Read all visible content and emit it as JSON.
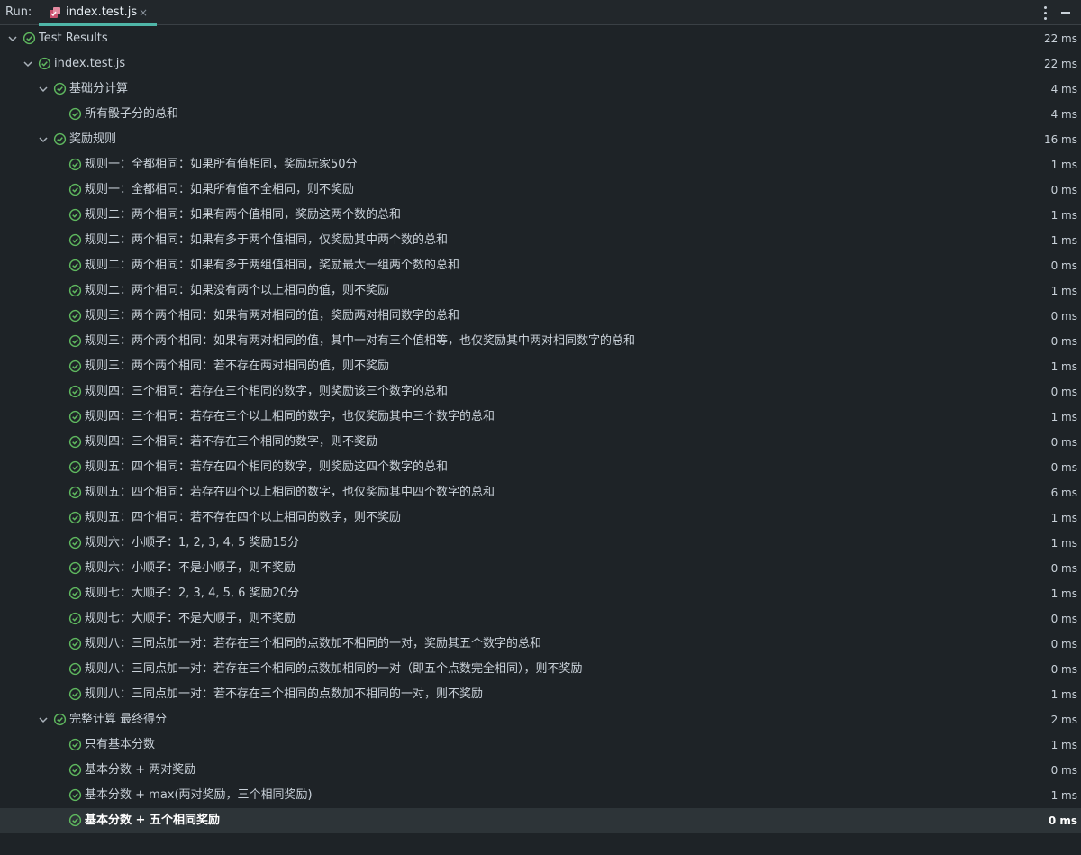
{
  "header": {
    "run_label": "Run:",
    "tab_title": "index.test.js",
    "tab_close": "×"
  },
  "colors": {
    "pass": "#5fb85f",
    "accent": "#4fb6a8",
    "background": "#1e2327",
    "selected_row": "#2d3438"
  },
  "icons": {
    "tab": "js-test-file-icon",
    "status": "passed-check-icon",
    "expand": "chevron-down-icon",
    "menu": "more-vertical-icon",
    "minimize": "minimize-icon"
  },
  "tree": [
    {
      "label": "Test Results",
      "duration": "22 ms",
      "level": 0,
      "expandable": true
    },
    {
      "label": "index.test.js",
      "duration": "22 ms",
      "level": 1,
      "expandable": true
    },
    {
      "label": "基础分计算",
      "duration": "4 ms",
      "level": 2,
      "expandable": true
    },
    {
      "label": "所有骰子分的总和",
      "duration": "4 ms",
      "level": 3,
      "expandable": false
    },
    {
      "label": "奖励规则",
      "duration": "16 ms",
      "level": 2,
      "expandable": true
    },
    {
      "label": "规则一：全都相同：如果所有值相同，奖励玩家50分",
      "duration": "1 ms",
      "level": 3,
      "expandable": false
    },
    {
      "label": "规则一：全都相同：如果所有值不全相同，则不奖励",
      "duration": "0 ms",
      "level": 3,
      "expandable": false
    },
    {
      "label": "规则二：两个相同：如果有两个值相同，奖励这两个数的总和",
      "duration": "1 ms",
      "level": 3,
      "expandable": false
    },
    {
      "label": "规则二：两个相同：如果有多于两个值相同，仅奖励其中两个数的总和",
      "duration": "1 ms",
      "level": 3,
      "expandable": false
    },
    {
      "label": "规则二：两个相同：如果有多于两组值相同，奖励最大一组两个数的总和",
      "duration": "0 ms",
      "level": 3,
      "expandable": false
    },
    {
      "label": "规则二：两个相同：如果没有两个以上相同的值，则不奖励",
      "duration": "1 ms",
      "level": 3,
      "expandable": false
    },
    {
      "label": "规则三：两个两个相同：如果有两对相同的值，奖励两对相同数字的总和",
      "duration": "0 ms",
      "level": 3,
      "expandable": false
    },
    {
      "label": "规则三：两个两个相同：如果有两对相同的值，其中一对有三个值相等，也仅奖励其中两对相同数字的总和",
      "duration": "0 ms",
      "level": 3,
      "expandable": false
    },
    {
      "label": "规则三：两个两个相同：若不存在两对相同的值，则不奖励",
      "duration": "1 ms",
      "level": 3,
      "expandable": false
    },
    {
      "label": "规则四：三个相同：若存在三个相同的数字，则奖励该三个数字的总和",
      "duration": "0 ms",
      "level": 3,
      "expandable": false
    },
    {
      "label": "规则四：三个相同：若存在三个以上相同的数字，也仅奖励其中三个数字的总和",
      "duration": "1 ms",
      "level": 3,
      "expandable": false
    },
    {
      "label": "规则四：三个相同：若不存在三个相同的数字，则不奖励",
      "duration": "0 ms",
      "level": 3,
      "expandable": false
    },
    {
      "label": "规则五：四个相同：若存在四个相同的数字，则奖励这四个数字的总和",
      "duration": "0 ms",
      "level": 3,
      "expandable": false
    },
    {
      "label": "规则五：四个相同：若存在四个以上相同的数字，也仅奖励其中四个数字的总和",
      "duration": "6 ms",
      "level": 3,
      "expandable": false
    },
    {
      "label": "规则五：四个相同：若不存在四个以上相同的数字，则不奖励",
      "duration": "1 ms",
      "level": 3,
      "expandable": false
    },
    {
      "label": "规则六：小顺子：1, 2, 3, 4, 5 奖励15分",
      "duration": "1 ms",
      "level": 3,
      "expandable": false
    },
    {
      "label": "规则六：小顺子：不是小顺子，则不奖励",
      "duration": "0 ms",
      "level": 3,
      "expandable": false
    },
    {
      "label": "规则七：大顺子：2, 3, 4, 5, 6 奖励20分",
      "duration": "1 ms",
      "level": 3,
      "expandable": false
    },
    {
      "label": "规则七：大顺子：不是大顺子，则不奖励",
      "duration": "0 ms",
      "level": 3,
      "expandable": false
    },
    {
      "label": "规则八：三同点加一对：若存在三个相同的点数加不相同的一对，奖励其五个数字的总和",
      "duration": "0 ms",
      "level": 3,
      "expandable": false
    },
    {
      "label": "规则八：三同点加一对：若存在三个相同的点数加相同的一对（即五个点数完全相同），则不奖励",
      "duration": "0 ms",
      "level": 3,
      "expandable": false
    },
    {
      "label": "规则八：三同点加一对：若不存在三个相同的点数加不相同的一对，则不奖励",
      "duration": "1 ms",
      "level": 3,
      "expandable": false
    },
    {
      "label": "完整计算 最终得分",
      "duration": "2 ms",
      "level": 2,
      "expandable": true
    },
    {
      "label": "只有基本分数",
      "duration": "1 ms",
      "level": 3,
      "expandable": false
    },
    {
      "label": "基本分数 + 两对奖励",
      "duration": "0 ms",
      "level": 3,
      "expandable": false
    },
    {
      "label": "基本分数 + max(两对奖励，三个相同奖励)",
      "duration": "1 ms",
      "level": 3,
      "expandable": false
    },
    {
      "label": "基本分数 + 五个相同奖励",
      "duration": "0 ms",
      "level": 3,
      "expandable": false,
      "selected": true
    }
  ]
}
